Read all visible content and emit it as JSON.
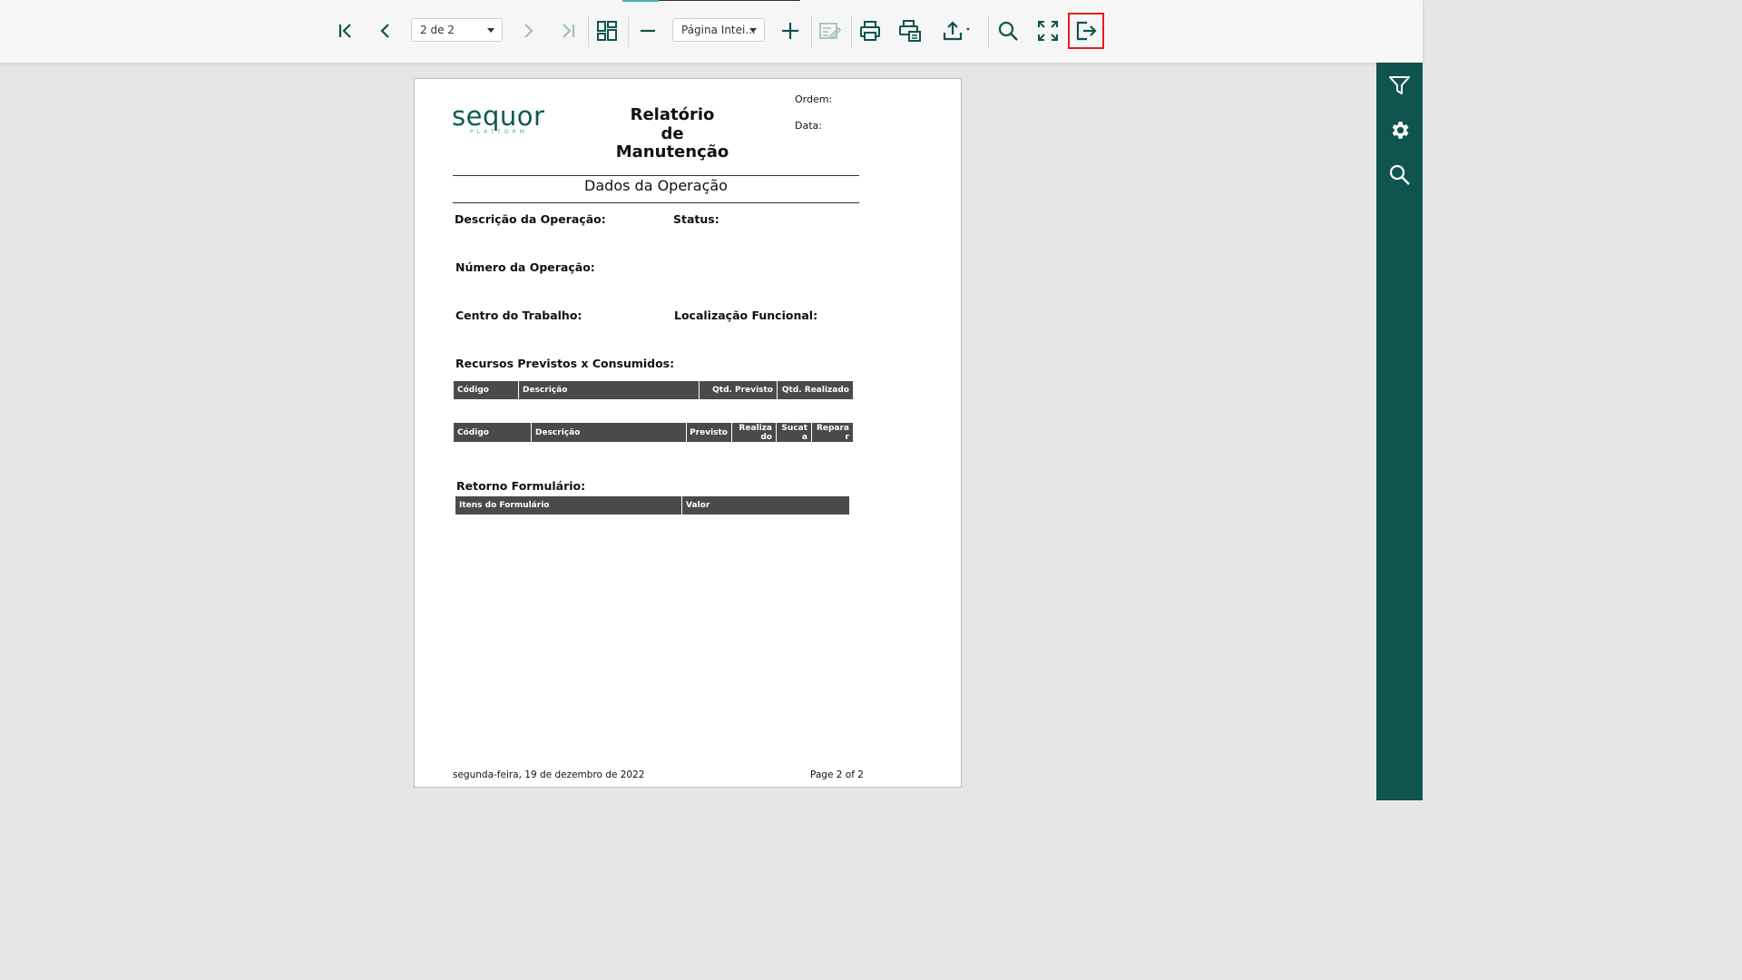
{
  "toolbar": {
    "page_select": "2 de 2",
    "zoom_select": "Página Intei..."
  },
  "report": {
    "logo_text": "sequor",
    "logo_subtext": "PLATFORM",
    "title_line1": "Relatório",
    "title_line2": "de",
    "title_line3": "Manutenção",
    "order_label": "Ordem:",
    "date_label": "Data:",
    "section_title": "Dados da Operação",
    "fields": {
      "operation_description": "Descrição da Operação:",
      "status": "Status:",
      "operation_number": "Número da Operação:",
      "work_center": "Centro do Trabalho:",
      "functional_location": "Localização Funcional:",
      "resources": "Recursos Previstos x Consumidos:",
      "form_return": "Retorno Formulário:"
    },
    "table1": [
      "Código",
      "Descrição",
      "Qtd. Previsto",
      "Qtd. Realizado"
    ],
    "table2": [
      "Código",
      "Descrição",
      "Previsto",
      "Realizado",
      "Sucata",
      "Reparar"
    ],
    "table3": [
      "Itens do Formulário",
      "Valor"
    ],
    "footer_date": "segunda-feira, 19 de dezembro de 2022",
    "footer_page": "Page 2 of 2"
  },
  "colors": {
    "sidebar": "#0f544e",
    "brand_accent": "#3fb8b0",
    "table_header": "#4a4a4a",
    "highlight": "#e41e1e"
  },
  "icons": [
    "first-page-icon",
    "previous-page-icon",
    "next-page-icon",
    "last-page-icon",
    "thumbnails-icon",
    "zoom-out-icon",
    "zoom-in-icon",
    "edit-icon",
    "print-icon",
    "print-page-icon",
    "export-icon",
    "search-icon",
    "fullscreen-icon",
    "exit-icon",
    "filter-icon",
    "gear-icon"
  ]
}
